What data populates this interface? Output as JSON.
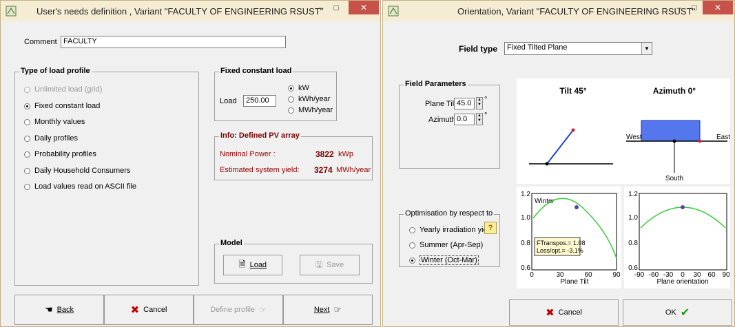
{
  "left": {
    "title": "User's needs definition , Variant  \"FACULTY OF ENGINEERING RSUST\"",
    "comment_label": "Comment",
    "comment_value": "FACULTY",
    "load_profile": {
      "title": "Type of load profile",
      "options": [
        "Unlimited load (grid)",
        "Fixed constant load",
        "Monthly values",
        "Daily profiles",
        "Probability profiles",
        "Daily Household  Consumers",
        "Load values read on ASCII file"
      ],
      "selected": "Fixed constant load"
    },
    "fixed_load": {
      "title": "Fixed constant load",
      "load_label": "Load",
      "load_value": "250.00",
      "units": [
        "kW",
        "kWh/year",
        "MWh/year"
      ],
      "selected_unit": "kW"
    },
    "info": {
      "title": "Info:  Defined PV array",
      "nominal_label": "Nominal Power :",
      "nominal_value": "3822",
      "nominal_unit": "kWp",
      "yield_label": "Estimated system yield:",
      "yield_value": "3274",
      "yield_unit": "MWh/year"
    },
    "model": {
      "title": "Model",
      "load_btn": "Load",
      "save_btn": "Save"
    },
    "footer": {
      "back": "Back",
      "cancel": "Cancel",
      "define": "Define profile",
      "next": "Next"
    }
  },
  "right": {
    "title": "Orientation, Variant \"FACULTY OF ENGINEERING RSUST\"",
    "field_type_label": "Field type",
    "field_type_value": "Fixed Tilted Plane",
    "field_params": {
      "title": "Field Parameters",
      "tilt_label": "Plane Tilt",
      "tilt_value": "45.0",
      "azimuth_label": "Azimuth",
      "azimuth_value": "0.0",
      "degree": "°"
    },
    "diagram": {
      "tilt_title": "Tilt 45°",
      "azimuth_title": "Azimuth 0°",
      "west": "West",
      "east": "East",
      "south": "South"
    },
    "optimisation": {
      "title": "Optimisation by respect to",
      "options": [
        "Yearly irradiation yield",
        "Summer (Apr-Sep)",
        "Winter (Oct-Mar)"
      ],
      "selected": "Winter (Oct-Mar)",
      "help": "?"
    },
    "plot_tilt": {
      "season_label": "Winter",
      "ftranspos": "FTranspos.= 1.08",
      "loss": "Loss/opt.= -3.1%",
      "y_ticks": [
        "1.2",
        "1.0",
        "0.8",
        "0.6"
      ],
      "x_ticks": [
        "0",
        "30",
        "60",
        "90"
      ],
      "xlabel": "Plane Tilt"
    },
    "plot_orient": {
      "y_ticks": [
        "1.2",
        "1.0",
        "0.8",
        "0.6"
      ],
      "x_ticks": [
        "-90",
        "-60",
        "-30",
        "0",
        "30",
        "60",
        "90"
      ],
      "xlabel": "Plane orientation"
    },
    "footer": {
      "cancel": "Cancel",
      "ok": "OK"
    }
  },
  "colors": {
    "titlebar": "#f5ecd4",
    "close": "#c7524a",
    "curve": "#33cc33",
    "marker": "#5a3fb0",
    "azimuth_rect": "#5577ee",
    "info_title": "#7a0000"
  }
}
